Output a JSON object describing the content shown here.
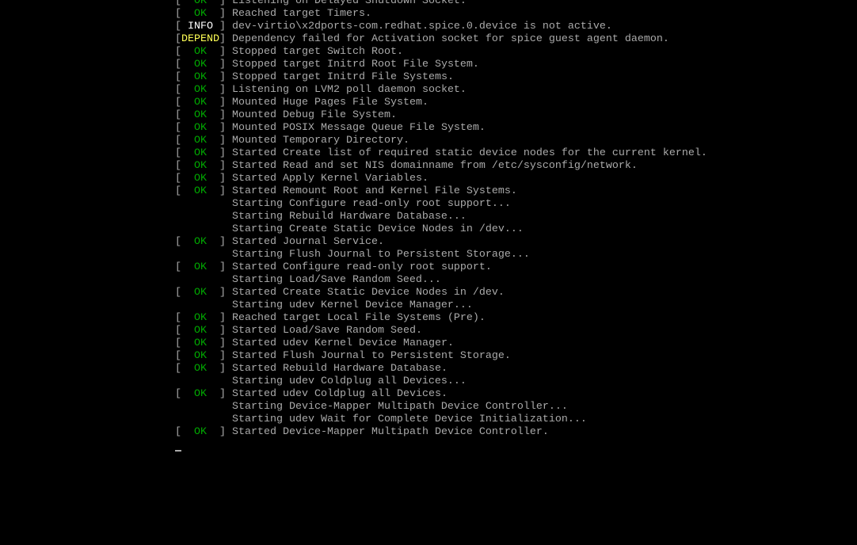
{
  "colors": {
    "text": "#aaaaaa",
    "ok": "#00aa00",
    "info": "#ffffff",
    "depend": "#ffff55",
    "background": "#000000"
  },
  "lines": [
    {
      "status": "OK",
      "text": "Listening on Delayed Shutdown Socket."
    },
    {
      "status": "OK",
      "text": "Reached target Timers."
    },
    {
      "status": "INFO",
      "text": "dev-virtio\\x2dports-com.redhat.spice.0.device is not active."
    },
    {
      "status": "DEPEND",
      "text": "Dependency failed for Activation socket for spice guest agent daemon."
    },
    {
      "status": "OK",
      "text": "Stopped target Switch Root."
    },
    {
      "status": "OK",
      "text": "Stopped target Initrd Root File System."
    },
    {
      "status": "OK",
      "text": "Stopped target Initrd File Systems."
    },
    {
      "status": "OK",
      "text": "Listening on LVM2 poll daemon socket."
    },
    {
      "status": "OK",
      "text": "Mounted Huge Pages File System."
    },
    {
      "status": "OK",
      "text": "Mounted Debug File System."
    },
    {
      "status": "OK",
      "text": "Mounted POSIX Message Queue File System."
    },
    {
      "status": "OK",
      "text": "Mounted Temporary Directory."
    },
    {
      "status": "OK",
      "text": "Started Create list of required static device nodes for the current kernel."
    },
    {
      "status": "OK",
      "text": "Started Read and set NIS domainname from /etc/sysconfig/network."
    },
    {
      "status": "OK",
      "text": "Started Apply Kernel Variables."
    },
    {
      "status": "OK",
      "text": "Started Remount Root and Kernel File Systems."
    },
    {
      "status": "",
      "text": "Starting Configure read-only root support..."
    },
    {
      "status": "",
      "text": "Starting Rebuild Hardware Database..."
    },
    {
      "status": "",
      "text": "Starting Create Static Device Nodes in /dev..."
    },
    {
      "status": "OK",
      "text": "Started Journal Service."
    },
    {
      "status": "",
      "text": "Starting Flush Journal to Persistent Storage..."
    },
    {
      "status": "OK",
      "text": "Started Configure read-only root support."
    },
    {
      "status": "",
      "text": "Starting Load/Save Random Seed..."
    },
    {
      "status": "OK",
      "text": "Started Create Static Device Nodes in /dev."
    },
    {
      "status": "",
      "text": "Starting udev Kernel Device Manager..."
    },
    {
      "status": "OK",
      "text": "Reached target Local File Systems (Pre)."
    },
    {
      "status": "OK",
      "text": "Started Load/Save Random Seed."
    },
    {
      "status": "OK",
      "text": "Started udev Kernel Device Manager."
    },
    {
      "status": "OK",
      "text": "Started Flush Journal to Persistent Storage."
    },
    {
      "status": "OK",
      "text": "Started Rebuild Hardware Database."
    },
    {
      "status": "",
      "text": "Starting udev Coldplug all Devices..."
    },
    {
      "status": "OK",
      "text": "Started udev Coldplug all Devices."
    },
    {
      "status": "",
      "text": "Starting Device-Mapper Multipath Device Controller..."
    },
    {
      "status": "",
      "text": "Starting udev Wait for Complete Device Initialization..."
    },
    {
      "status": "OK",
      "text": "Started Device-Mapper Multipath Device Controller."
    }
  ]
}
